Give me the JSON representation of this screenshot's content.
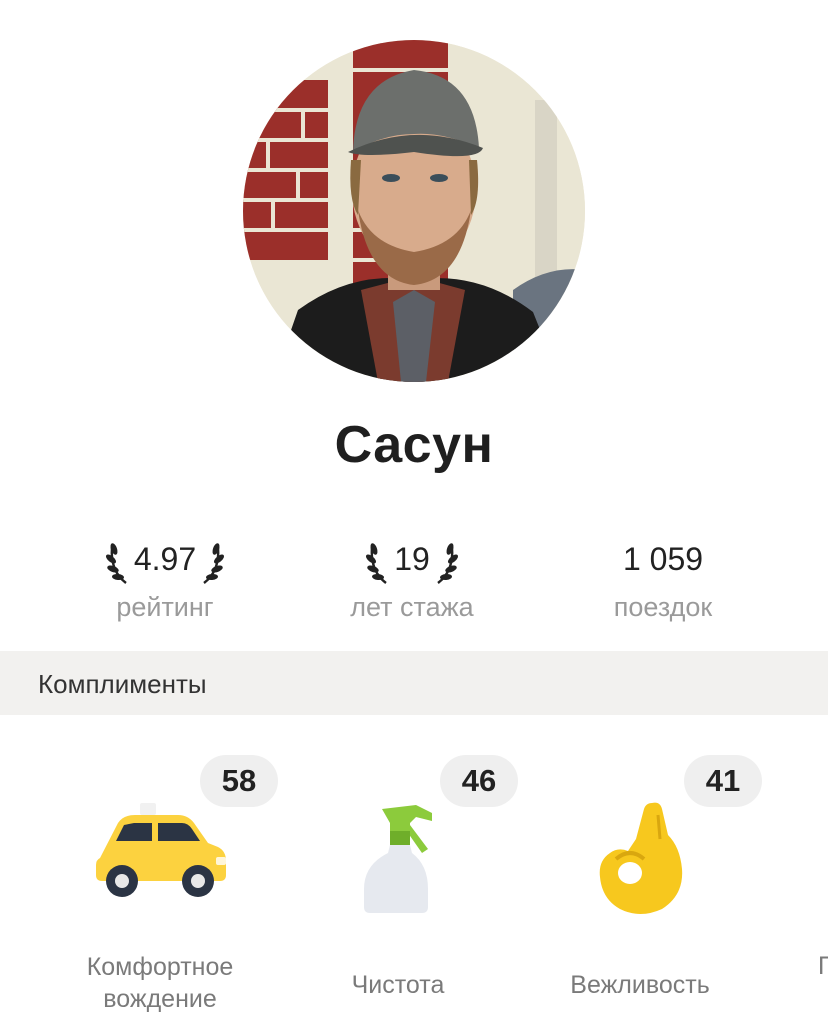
{
  "driver": {
    "name": "Сасун"
  },
  "stats": [
    {
      "value": "4.97",
      "label": "рейтинг",
      "laurel": true
    },
    {
      "value": "19",
      "label": "лет стажа",
      "laurel": true
    },
    {
      "value": "1 059",
      "label": "поездок",
      "laurel": false
    }
  ],
  "compliments_section": {
    "title": "Комплименты"
  },
  "compliments": [
    {
      "count": "58",
      "label": "Комфортное вождение",
      "icon": "taxi-car-icon"
    },
    {
      "count": "46",
      "label": "Чистота",
      "icon": "spray-bottle-icon"
    },
    {
      "count": "41",
      "label": "Вежливость",
      "icon": "ok-hand-icon"
    },
    {
      "count": "",
      "label": "П",
      "icon": ""
    }
  ],
  "colors": {
    "taxi_yellow": "#FCD23F",
    "spray_green": "#8CCB3C",
    "hand_yellow": "#F7C81E",
    "section_bg": "#F2F1EF",
    "badge_bg": "#EFEFEF"
  }
}
